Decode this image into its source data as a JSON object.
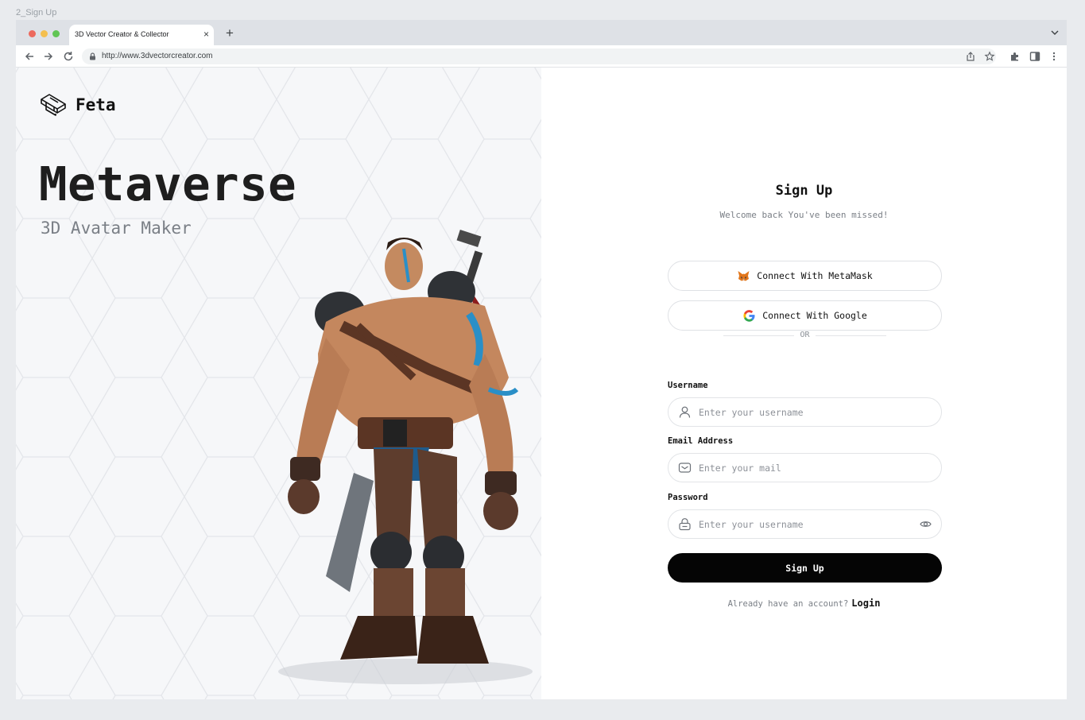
{
  "frame_label": "2_Sign Up",
  "browser": {
    "tab_title": "3D Vector Creator & Collector",
    "tab_close": "×",
    "new_tab": "+",
    "url": "http://www.3dvectorcreator.com"
  },
  "brand": {
    "name": "Feta"
  },
  "hero": {
    "title": "Metaverse",
    "subtitle": "3D Avatar Maker"
  },
  "signup": {
    "title": "Sign Up",
    "subtitle": "Welcome back You've been missed!",
    "metamask_label": "Connect With MetaMask",
    "google_label": "Connect With Google",
    "divider_text": "OR",
    "fields": {
      "username": {
        "label": "Username",
        "placeholder": "Enter your username"
      },
      "email": {
        "label": "Email Address",
        "placeholder": "Enter your mail"
      },
      "password": {
        "label": "Password",
        "placeholder": "Enter your username"
      }
    },
    "submit_label": "Sign Up",
    "footer_text": "Already have an account?",
    "login_label": "Login"
  },
  "colors": {
    "accent": "#050505",
    "left_bg": "#f6f7f9",
    "muted": "#7a7f86"
  }
}
